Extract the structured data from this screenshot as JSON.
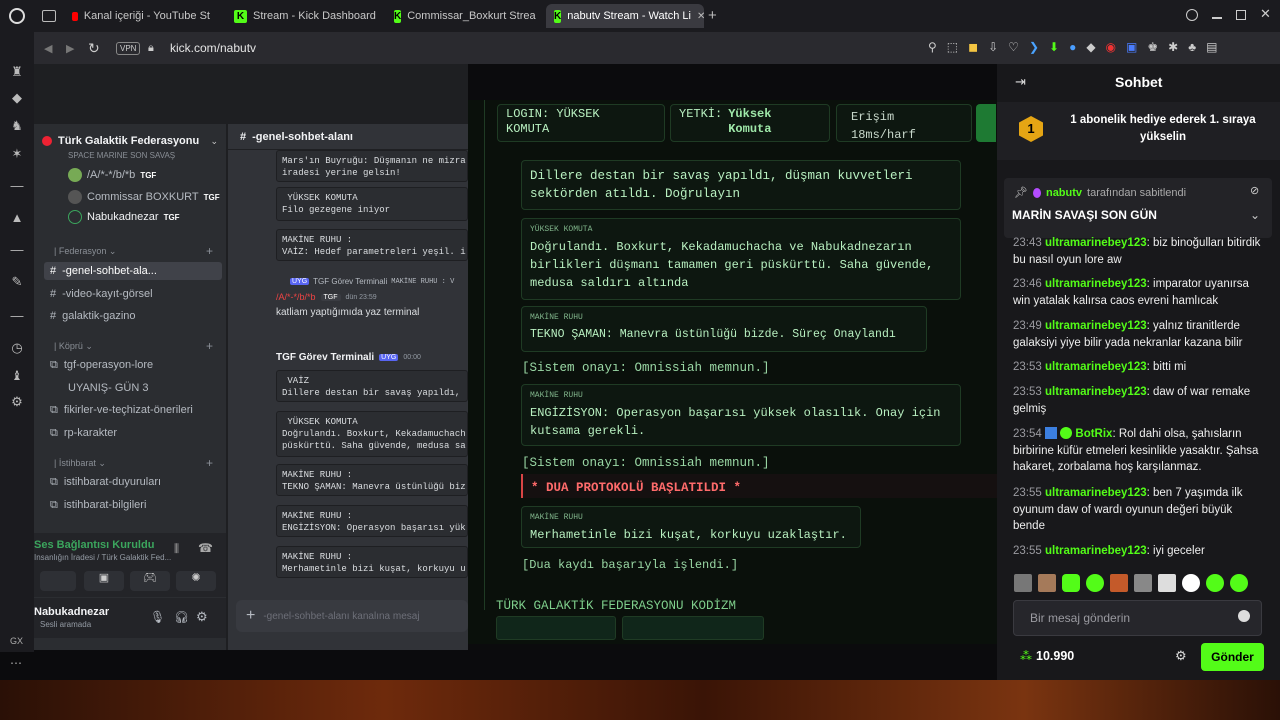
{
  "browser": {
    "tabs": [
      {
        "label": "Kanal içeriği - YouTube St",
        "icon": "youtube-icon"
      },
      {
        "label": "Stream - Kick Dashboard",
        "icon": "kick-icon"
      },
      {
        "label": "Commissar_Boxkurt Strea",
        "icon": "kick-icon"
      },
      {
        "label": "nabutv Stream - Watch Li",
        "icon": "kick-icon"
      }
    ],
    "vpn_label": "VPN",
    "url": "kick.com/nabutv"
  },
  "discord": {
    "server_name": "Türk Galaktik Federasyonu",
    "section_top": "SPACE MARINE SON SAVAŞ",
    "voice_members": [
      {
        "name": "/A/*-*/b/*b",
        "tag": "TGF"
      },
      {
        "name": "Commissar BOXKURT",
        "tag": "TGF"
      },
      {
        "name": "Nabukadnezar",
        "tag": "TGF"
      }
    ],
    "cat_federasyon": "| Federasyon",
    "channels_fed": [
      "-genel-sohbet-ala...",
      "-video-kayıt-görsel",
      "galaktik-gazino"
    ],
    "cat_kopru": "| Köprü",
    "channels_kopru": [
      "tgf-operasyon-lore",
      "UYANIŞ- GÜN 3",
      "fikirler-ve-teçhizat-önerileri",
      "rp-karakter"
    ],
    "cat_istihbarat": "| İstihbarat",
    "channels_ist": [
      "istihbarat-duyuruları",
      "istihbarat-bilgileri"
    ],
    "voice_status": "Ses Bağlantısı Kuruldu",
    "voice_sub": "Insanlığın İradesi / Türk Galaktik Fed...",
    "user_name": "Nabukadnezar",
    "user_status": "Sesli aramada",
    "channel_header": "-genel-sohbet-alanı",
    "chat_input_placeholder": "-genel-sohbet-alanı kanalına mesaj",
    "msgs": [
      {
        "text": "Mars'ın Buyruğu: Düşmanın ne mizra\niradesi yerine gelsin!"
      },
      {
        "text": " YÜKSEK KOMUTA\nFilo gezegene iniyor"
      },
      {
        "text": "MAKİNE RUHU :\nVAİZ: Hedef parametreleri yeşil. i"
      }
    ],
    "reply_author": "TGF Görev Terminali",
    "reply_author_badge": "UYG",
    "reply_snip": "MAKİNE RUHU : V",
    "user2": "/A/*-*/b/*b",
    "user2_tag": "TGF",
    "user2_time": "dün 23:59",
    "user2_msg": "katliam yaptığımıda yaz terminal",
    "bot_name": "TGF Görev Terminali",
    "bot_badge": "UYG",
    "bot_time": "00:00",
    "bot_msgs": [
      {
        "text": " VAİZ\nDillere destan bir savaş yapıldı,"
      },
      {
        "text": " YÜKSEK KOMUTA\nDoğrulandı. Boxkurt, Kekadamuchach\npüskürttü. Saha güvende, medusa sa"
      },
      {
        "text": "MAKİNE RUHU :\nTEKNO ŞAMAN: Manevra üstünlüğü biz"
      },
      {
        "text": "MAKİNE RUHU :\nENGİZİSYON: Operasyon başarısı yük"
      },
      {
        "text": "MAKİNE RUHU :\nMerhametinle bizi kuşat, korkuyu u"
      }
    ]
  },
  "terminal": {
    "login_label": "LOGIN: YÜKSEK\nKOMUTA",
    "auth_label": "YETKİ:",
    "auth_value": "Yüksek\nKomuta",
    "access_label": "Erişim\n18ms/harf",
    "blocks": [
      {
        "who": "",
        "text": "Dillere destan bir savaş yapıldı, düşman kuvvetleri\nsektörden atıldı. Doğrulayın"
      },
      {
        "who": "YÜKSEK KOMUTA",
        "text": "Doğrulandı. Boxkurt, Kekadamuchacha ve Nabukadnezarın\nbirlikleri düşmanı tamamen geri püskürttü. Saha güvende,\nmedusa saldırı altında"
      },
      {
        "who": "MAKİNE RUHU",
        "text": "TEKNO ŞAMAN: Manevra üstünlüğü bizde. Süreç Onaylandı"
      },
      {
        "who": "MAKİNE RUHU",
        "text": "ENGİZİSYON: Operasyon başarısı yüksek olasılık. Onay için\nkutsama gerekli."
      },
      {
        "who": "MAKİNE RUHU",
        "text": "Merhametinle bizi kuşat, korkuyu uzaklaştır."
      }
    ],
    "sys1": "[Sistem onayı: Omnissiah memnun.]",
    "sys2": "[Sistem onayı: Omnissiah memnun.]",
    "prayer": "* DUA PROTOKOLÜ BAŞLATILDI *",
    "dua_done": "[Dua kaydı başarıyla işlendi.]",
    "footer": "TÜRK GALAKTİK FEDERASYONU KODİZM"
  },
  "chat": {
    "title": "Sohbet",
    "gift_rank": "1",
    "gift_text": "1 abonelik hediye ederek 1. sıraya yükselin",
    "pinned_by_user": "nabutv",
    "pinned_by_text": "tarafından sabitlendi",
    "pinned_message": "MARİN SAVAŞI SON GÜN",
    "messages": [
      {
        "time": "23:43",
        "user": "ultramarinebey123",
        "text": "biz binoğulları bitirdik bu nasıl oyun lore aw"
      },
      {
        "time": "23:46",
        "user": "ultramarinebey123",
        "text": "imparator uyanırsa win yatalak kalırsa caos evreni hamlıcak"
      },
      {
        "time": "23:49",
        "user": "ultramarinebey123",
        "text": "yalnız tiranitlerde galaksiyi yiye bilir yada nekranlar kazana bilir"
      },
      {
        "time": "23:53",
        "user": "ultramarinebey123",
        "text": "bitti mi"
      },
      {
        "time": "23:53",
        "user": "ultramarinebey123",
        "text": "daw of war remake gelmiş"
      },
      {
        "time": "23:54",
        "user": "BotRix",
        "text": "Rol dahi olsa, şahısların birbirine küfür etmeleri kesinlikle yasaktır. Şahsa hakaret, zorbalama hoş karşılanmaz."
      },
      {
        "time": "23:55",
        "user": "ultramarinebey123",
        "text": "ben 7 yaşımda ilk oyunum daw of wardı oyunun değeri büyük bende"
      },
      {
        "time": "23:55",
        "user": "ultramarinebey123",
        "text": "iyi geceler"
      }
    ],
    "input_placeholder": "Bir mesaj gönderin",
    "points": "10.990",
    "send_label": "Gönder"
  },
  "left_bottom_label": "GX",
  "colors": {
    "kick_green": "#53fc18",
    "terminal_green": "#b8f0c0",
    "prayer_red": "#ff6b6b"
  }
}
